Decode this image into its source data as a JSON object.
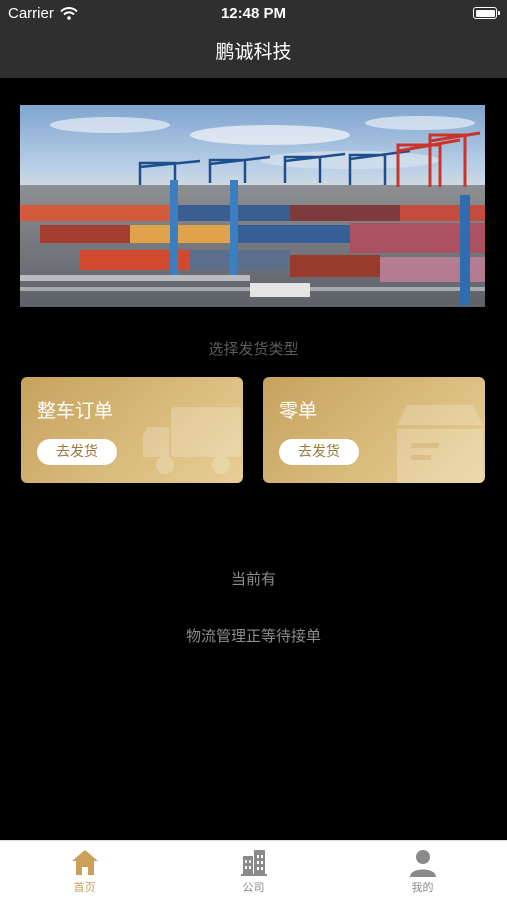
{
  "status_bar": {
    "carrier": "Carrier",
    "time": "12:48 PM"
  },
  "nav": {
    "title": "鹏诚科技"
  },
  "section": {
    "title": "选择发货类型"
  },
  "cards": [
    {
      "title": "整车订单",
      "button": "去发货",
      "icon": "truck-icon"
    },
    {
      "title": "零单",
      "button": "去发货",
      "icon": "package-box-icon"
    }
  ],
  "info": {
    "line1": "当前有",
    "line2": "物流管理正等待接单"
  },
  "tabbar": {
    "items": [
      {
        "label": "首页",
        "icon": "home-icon",
        "active": true
      },
      {
        "label": "公司",
        "icon": "building-icon",
        "active": false
      },
      {
        "label": "我的",
        "icon": "user-icon",
        "active": false
      }
    ]
  },
  "colors": {
    "accent": "#c9a15a",
    "card_gradient_start": "#c6a25d",
    "card_gradient_end": "#e8cf95",
    "bar_background": "#2f2f2f",
    "page_background": "#000000"
  }
}
